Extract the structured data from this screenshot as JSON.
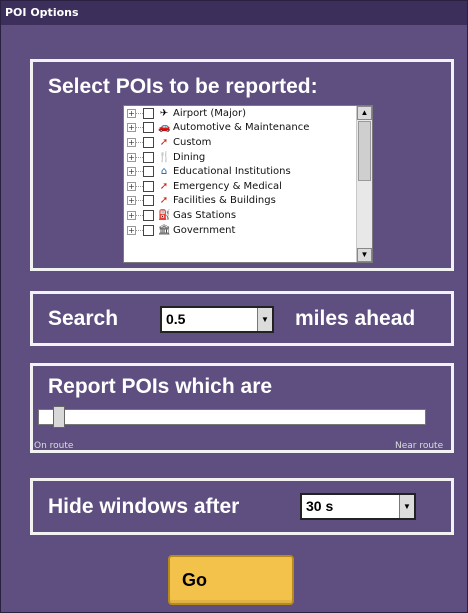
{
  "window": {
    "title": "POI Options"
  },
  "select_panel": {
    "title": "Select POIs to be reported:",
    "items": [
      {
        "label": "Airport (Major)",
        "icon": "airplane-icon"
      },
      {
        "label": "Automotive & Maintenance",
        "icon": "car-icon"
      },
      {
        "label": "Custom",
        "icon": "pin-icon"
      },
      {
        "label": "Dining",
        "icon": "fork-knife-icon"
      },
      {
        "label": "Educational Institutions",
        "icon": "school-icon"
      },
      {
        "label": "Emergency & Medical",
        "icon": "pin-icon"
      },
      {
        "label": "Facilities & Buildings",
        "icon": "pin-icon"
      },
      {
        "label": "Gas Stations",
        "icon": "gas-pump-icon"
      },
      {
        "label": "Government",
        "icon": "building-icon"
      }
    ]
  },
  "search_panel": {
    "label": "Search",
    "value": "0.5",
    "suffix": "miles ahead"
  },
  "report_panel": {
    "title": "Report POIs which are",
    "min_label": "On route",
    "max_label": "Near route",
    "slider_value": 0
  },
  "hide_panel": {
    "label": "Hide windows after",
    "value": "30 s"
  },
  "go_button": {
    "label": "Go"
  },
  "colors": {
    "background": "#5e4f80",
    "titlebar": "#3d2f5c",
    "go_button": "#f3c24a"
  }
}
